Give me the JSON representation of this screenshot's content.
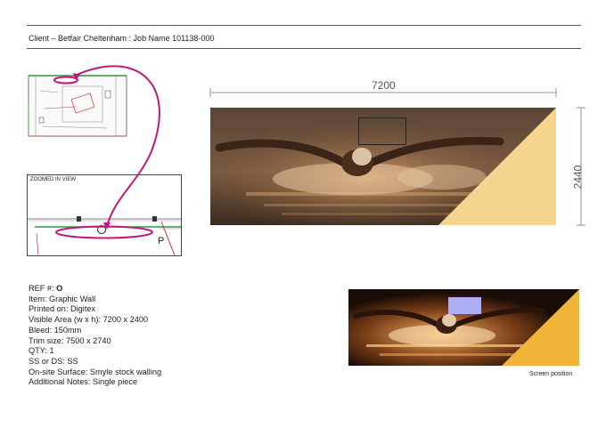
{
  "header": {
    "title": "Client – Betfair Cheltenham : Job Name 101138-000"
  },
  "drawing": {
    "zoom_label": "ZOOMED IN VIEW",
    "marker_label": "P"
  },
  "artwork": {
    "width_label": "7200",
    "height_label": "2440"
  },
  "specs": {
    "ref_label": "REF #:",
    "ref_value": "O",
    "item": "Item: Graphic Wall",
    "printed_on": "Printed on: Digitex",
    "visible_area": "Visible Area (w x h): 7200 x 2400",
    "bleed": "Bleed: 150mm",
    "trim_size": "Trim size: 7500 x 2740",
    "qty": "QTY: 1",
    "ss_ds": "SS or DS: SS",
    "surface": "On-site Surface: Smyle stock walling",
    "notes": "Additional Notes: Single piece"
  },
  "preview": {
    "caption": "Screen position"
  },
  "colors": {
    "accent_magenta": "#c2187a",
    "triangle_top": "#f4d48e",
    "triangle_bottom": "#f1b53a",
    "screen_marker": "#aeaef6",
    "photo_dark": "#2a1a10"
  }
}
